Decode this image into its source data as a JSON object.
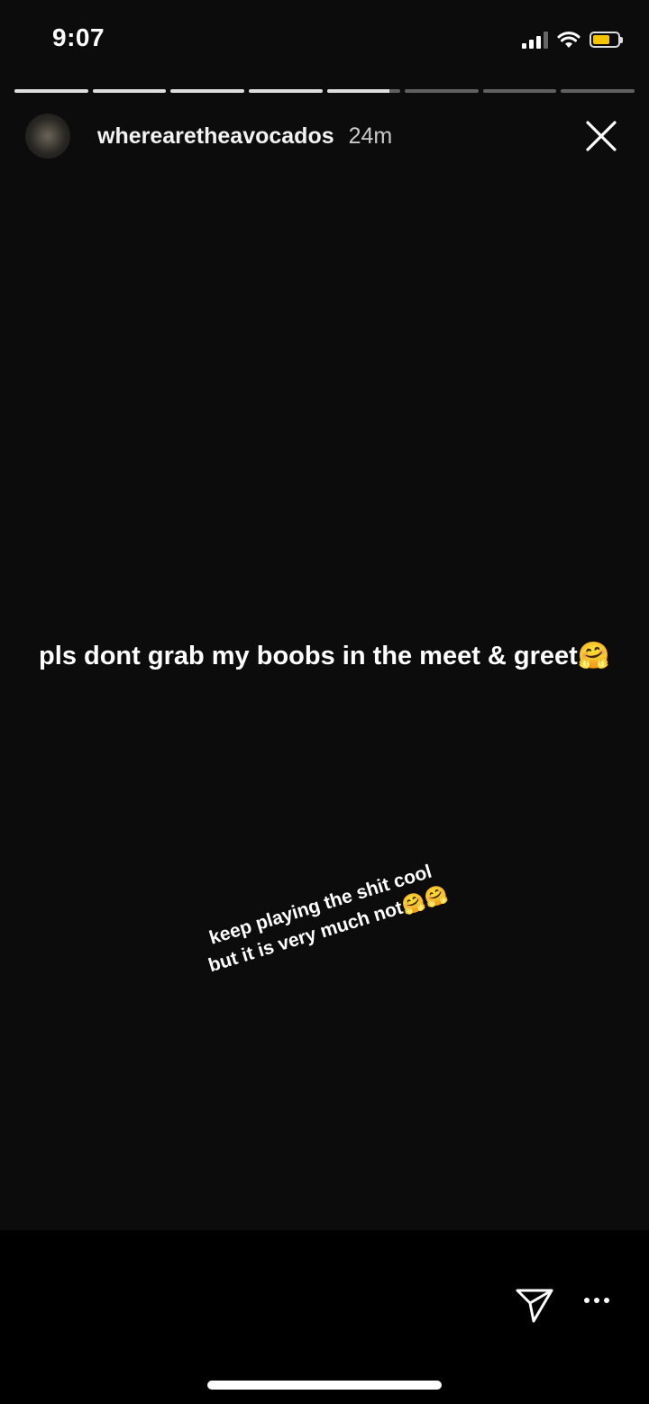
{
  "status_bar": {
    "time": "9:07",
    "signal_icon": "cellular-signal-icon",
    "wifi_icon": "wifi-icon",
    "battery_icon": "battery-icon",
    "battery_color": "#f5c400"
  },
  "story": {
    "progress_total_segments": 8,
    "progress_completed_segments": 5,
    "current_segment_progress": 0.85,
    "username": "wherearetheavocados",
    "posted_ago": "24m",
    "close_icon": "close-icon",
    "caption_main": "pls dont grab my boobs in the meet & greet",
    "caption_main_emoji": "🤗",
    "caption_tilted_line1": "keep playing the shit cool",
    "caption_tilted_line2": "but it is very much not",
    "caption_tilted_emoji": "🤗🤗"
  },
  "footer": {
    "send_icon": "send-icon",
    "more_icon": "more-options-icon"
  }
}
